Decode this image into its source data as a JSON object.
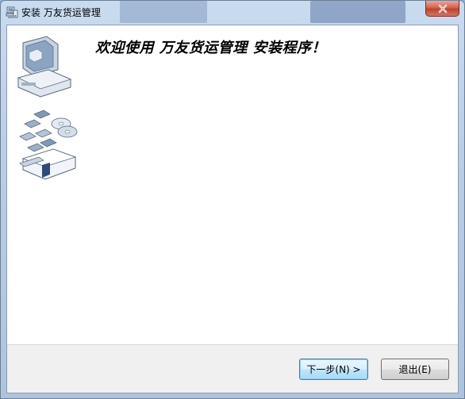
{
  "window": {
    "title": "安装 万友货运管理",
    "close_label": "✕"
  },
  "content": {
    "welcome_heading": "欢迎使用 万友货运管理 安装程序！"
  },
  "buttons": {
    "next_label": "下一步(N) >",
    "exit_label": "退出(E)"
  },
  "icons": {
    "app": "setup-computer-icon",
    "illustration": "computer-discs-floppy-illustration",
    "close": "close-icon"
  },
  "colors": {
    "default_button_border": "#3c7fb1",
    "close_button": "#c1422b",
    "titlebar": "#b9cde4"
  }
}
